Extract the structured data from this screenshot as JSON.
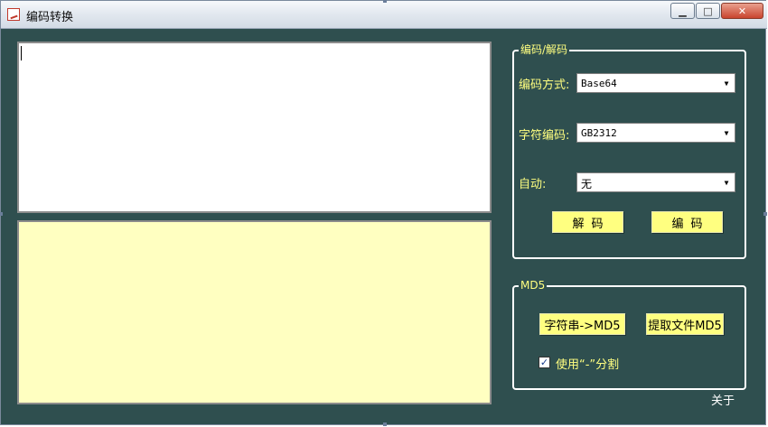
{
  "window": {
    "title": "编码转换"
  },
  "input_text": {
    "value": ""
  },
  "output_text": {
    "value": ""
  },
  "encode_group": {
    "label": "编码/解码",
    "encoding_method": {
      "label": "编码方式:",
      "value": "Base64"
    },
    "charset": {
      "label": "字符编码:",
      "value": "GB2312"
    },
    "auto": {
      "label": "自动:",
      "value": "无"
    },
    "decode_button": "解码",
    "encode_button": "编码"
  },
  "md5_group": {
    "label": "MD5",
    "string_md5_button": "字符串->MD5",
    "file_md5_button": "提取文件MD5",
    "use_dash": {
      "label": "使用“-”分割",
      "checked": true
    }
  },
  "about_link": "关于"
}
